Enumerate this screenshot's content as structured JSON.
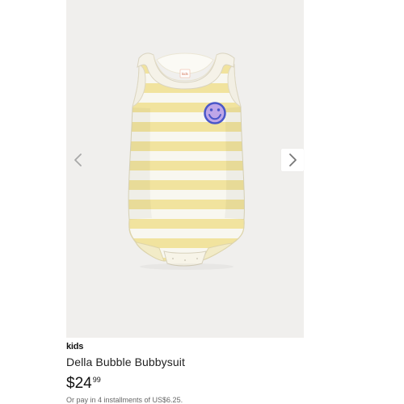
{
  "product": {
    "brand": "kids",
    "name": "Della Bubble Bubbysuit",
    "price_currency": "$",
    "price_dollars": "24",
    "price_cents": "99",
    "installments_text": "Or pay in 4 installments of US$6.25.",
    "label_text": "kids"
  },
  "gallery": {
    "background": "#f0efed",
    "prev_icon": "chevron-left-icon",
    "next_icon": "chevron-right-icon",
    "expand_icon": "expand-icon"
  },
  "colors": {
    "stripe_yellow": "#f1e39e",
    "stripe_white": "#f8f7f0",
    "smiley_blue": "#4a57c9",
    "smiley_purple": "#bea6e8",
    "text_dark": "#111111",
    "text_muted": "#666666"
  }
}
